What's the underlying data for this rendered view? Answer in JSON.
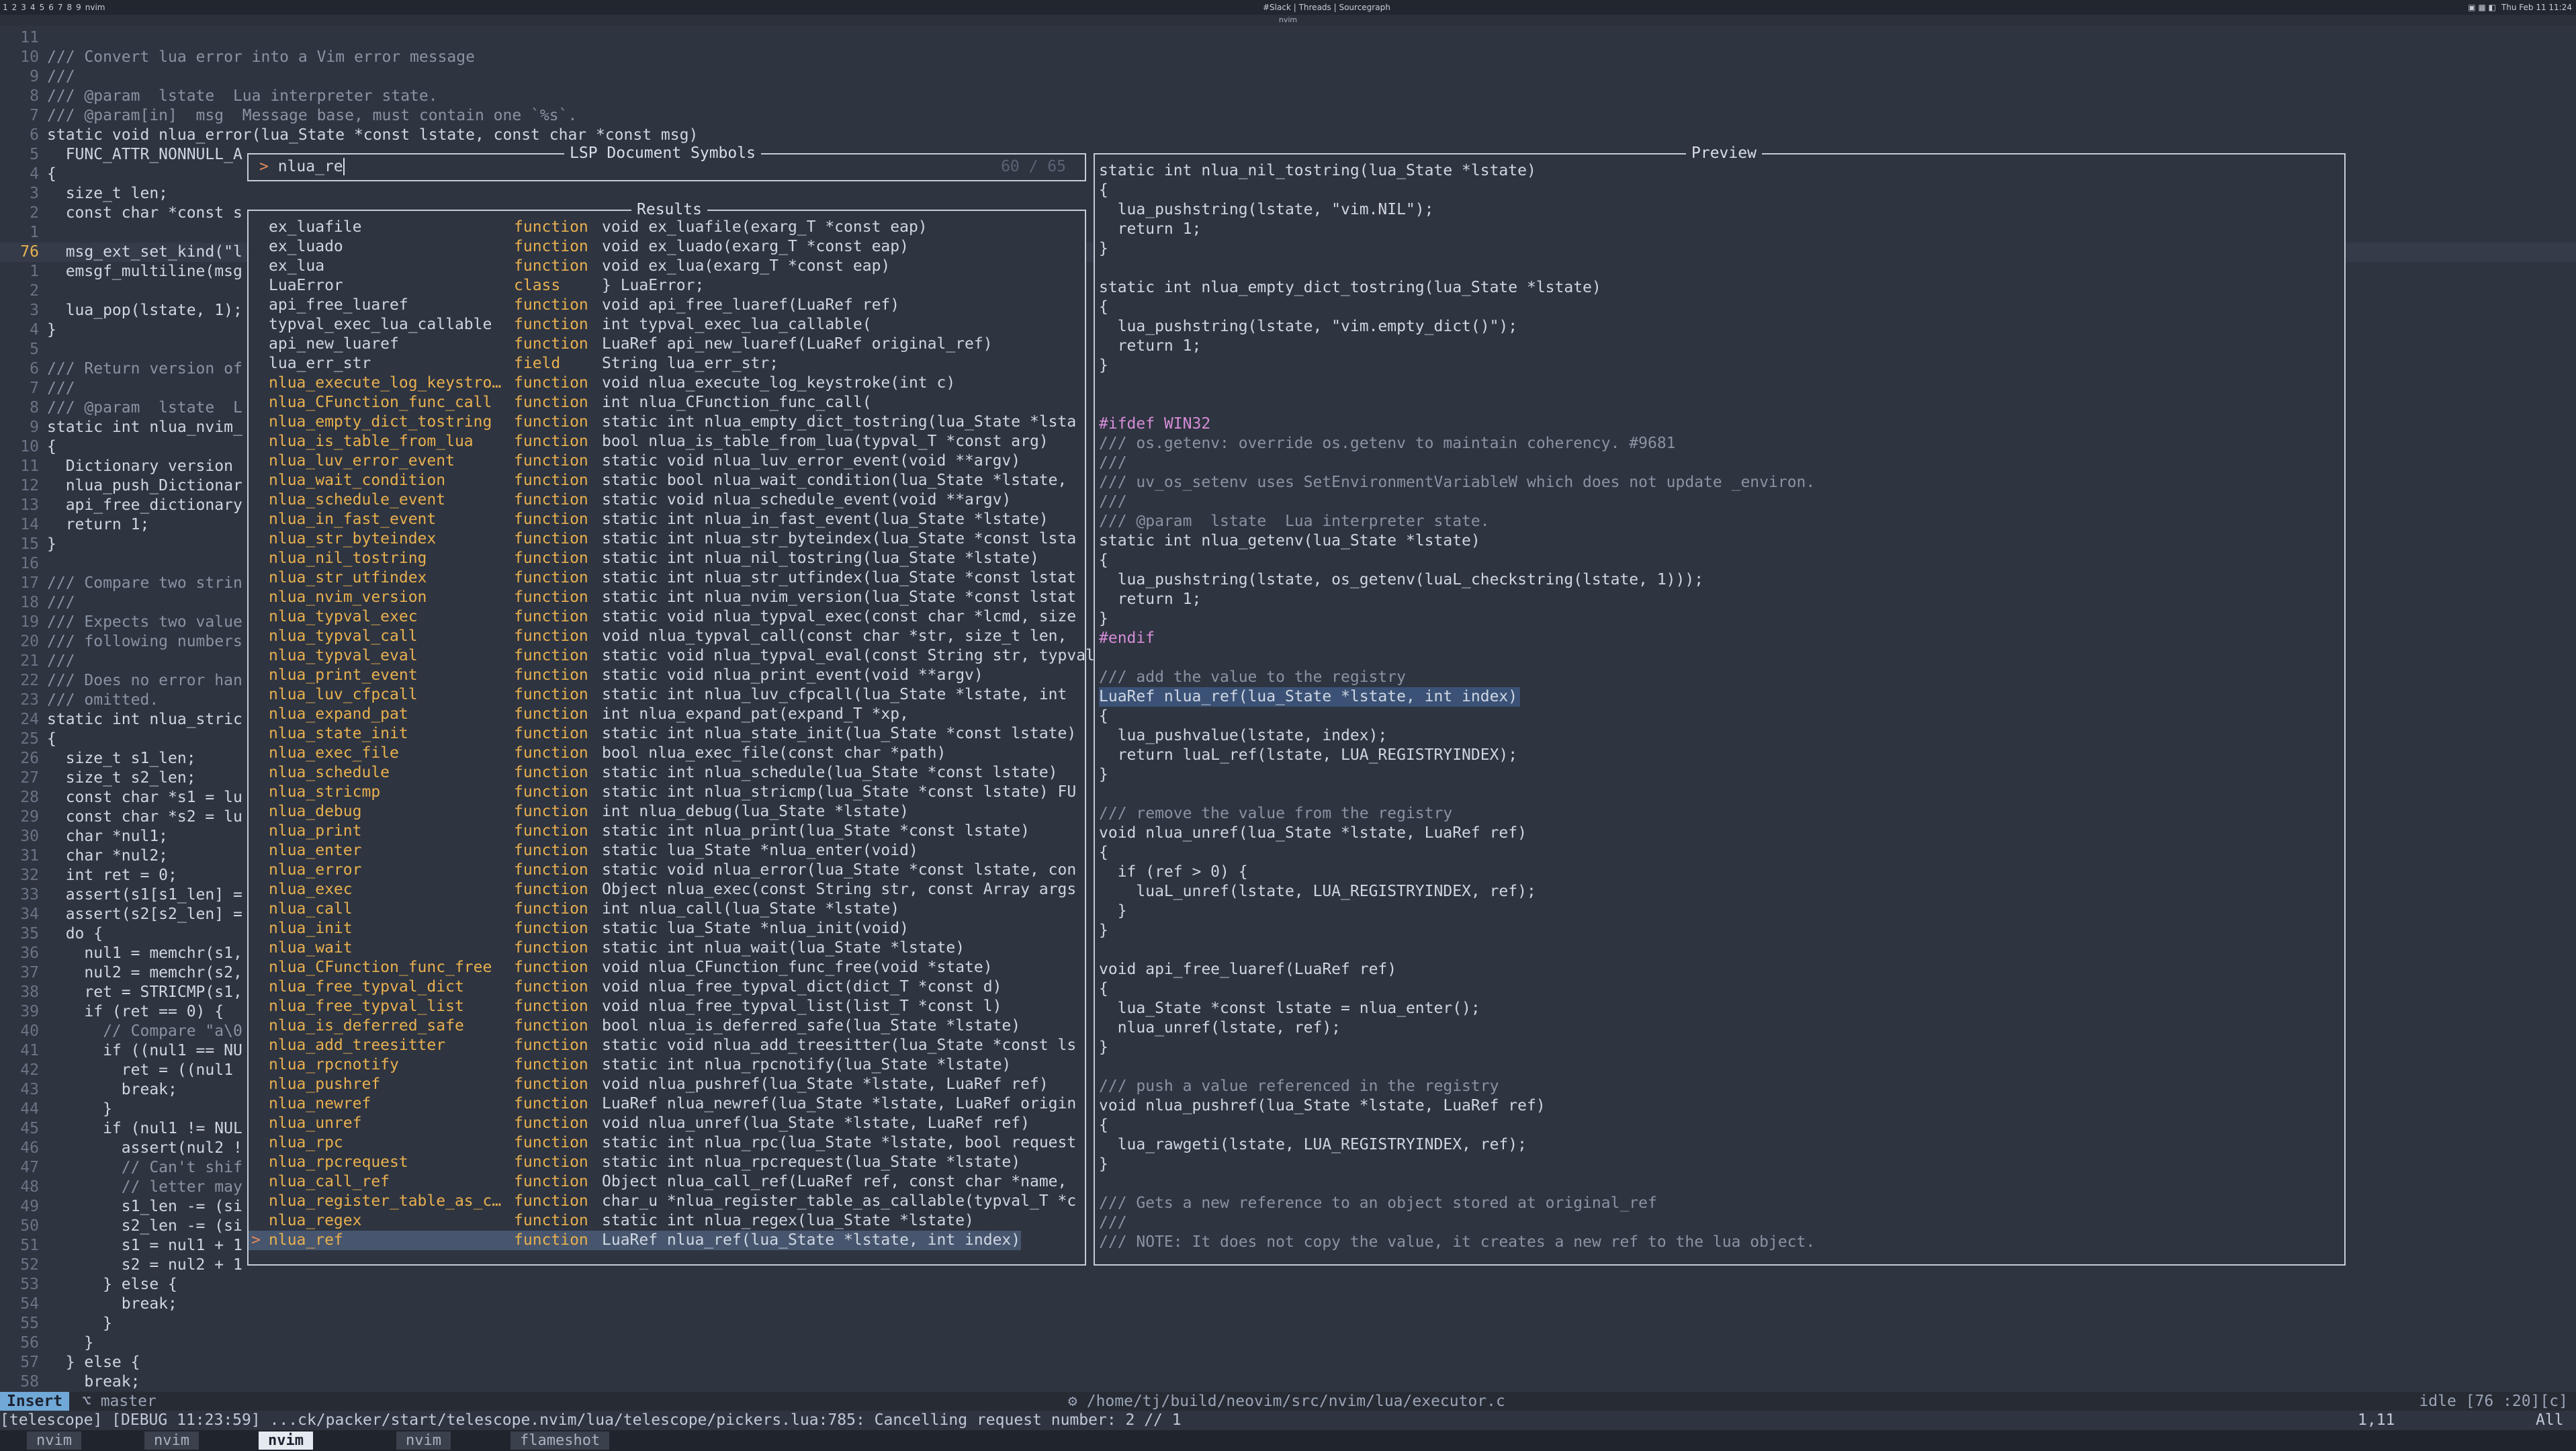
{
  "topbar": {
    "workspaces": [
      "1",
      "2",
      "3",
      "4",
      "5",
      "6",
      "7",
      "8",
      "9"
    ],
    "window_label": "nvim",
    "center": "#Slack | Threads | Sourcegraph",
    "right": "Thu Feb 11 11:24"
  },
  "window_title": "nvim",
  "editor": {
    "lines": [
      {
        "n": "11",
        "t": ""
      },
      {
        "n": "10",
        "t": "/// Convert lua error into a Vim error message"
      },
      {
        "n": "9",
        "t": "///"
      },
      {
        "n": "8",
        "t": "/// @param  lstate  Lua interpreter state."
      },
      {
        "n": "7",
        "t": "/// @param[in]  msg  Message base, must contain one `%s`."
      },
      {
        "n": "6",
        "t": "static void nlua_error(lua_State *const lstate, const char *const msg)"
      },
      {
        "n": "5",
        "t": "  FUNC_ATTR_NONNULL_A"
      },
      {
        "n": "4",
        "t": "{"
      },
      {
        "n": "3",
        "t": "  size_t len;"
      },
      {
        "n": "2",
        "t": "  const char *const s"
      },
      {
        "n": "1",
        "t": ""
      },
      {
        "n": "76",
        "t": "  msg_ext_set_kind(\"l"
      },
      {
        "n": "1",
        "t": "  emsgf_multiline(msg"
      },
      {
        "n": "2",
        "t": ""
      },
      {
        "n": "3",
        "t": "  lua_pop(lstate, 1);"
      },
      {
        "n": "4",
        "t": "}"
      },
      {
        "n": "5",
        "t": ""
      },
      {
        "n": "6",
        "t": "/// Return version of"
      },
      {
        "n": "7",
        "t": "///"
      },
      {
        "n": "8",
        "t": "/// @param  lstate  L"
      },
      {
        "n": "9",
        "t": "static int nlua_nvim_"
      },
      {
        "n": "10",
        "t": "{"
      },
      {
        "n": "11",
        "t": "  Dictionary version"
      },
      {
        "n": "12",
        "t": "  nlua_push_Dictionar"
      },
      {
        "n": "13",
        "t": "  api_free_dictionary"
      },
      {
        "n": "14",
        "t": "  return 1;"
      },
      {
        "n": "15",
        "t": "}"
      },
      {
        "n": "16",
        "t": ""
      },
      {
        "n": "17",
        "t": "/// Compare two strin"
      },
      {
        "n": "18",
        "t": "///"
      },
      {
        "n": "19",
        "t": "/// Expects two value"
      },
      {
        "n": "20",
        "t": "/// following numbers"
      },
      {
        "n": "21",
        "t": "///"
      },
      {
        "n": "22",
        "t": "/// Does no error han"
      },
      {
        "n": "23",
        "t": "/// omitted."
      },
      {
        "n": "24",
        "t": "static int nlua_stric"
      },
      {
        "n": "25",
        "t": "{"
      },
      {
        "n": "26",
        "t": "  size_t s1_len;"
      },
      {
        "n": "27",
        "t": "  size_t s2_len;"
      },
      {
        "n": "28",
        "t": "  const char *s1 = lu"
      },
      {
        "n": "29",
        "t": "  const char *s2 = lu"
      },
      {
        "n": "30",
        "t": "  char *nul1;"
      },
      {
        "n": "31",
        "t": "  char *nul2;"
      },
      {
        "n": "32",
        "t": "  int ret = 0;"
      },
      {
        "n": "33",
        "t": "  assert(s1[s1_len] ="
      },
      {
        "n": "34",
        "t": "  assert(s2[s2_len] ="
      },
      {
        "n": "35",
        "t": "  do {"
      },
      {
        "n": "36",
        "t": "    nul1 = memchr(s1,"
      },
      {
        "n": "37",
        "t": "    nul2 = memchr(s2,"
      },
      {
        "n": "38",
        "t": "    ret = STRICMP(s1,"
      },
      {
        "n": "39",
        "t": "    if (ret == 0) {"
      },
      {
        "n": "40",
        "t": "      // Compare \"a\\0"
      },
      {
        "n": "41",
        "t": "      if ((nul1 == NU"
      },
      {
        "n": "42",
        "t": "        ret = ((nul1"
      },
      {
        "n": "43",
        "t": "        break;"
      },
      {
        "n": "44",
        "t": "      }"
      },
      {
        "n": "45",
        "t": "      if (nul1 != NUL"
      },
      {
        "n": "46",
        "t": "        assert(nul2 !"
      },
      {
        "n": "47",
        "t": "        // Can't shif"
      },
      {
        "n": "48",
        "t": "        // letter may"
      },
      {
        "n": "49",
        "t": "        s1_len -= (si"
      },
      {
        "n": "50",
        "t": "        s2_len -= (si"
      },
      {
        "n": "51",
        "t": "        s1 = nul1 + 1"
      },
      {
        "n": "52",
        "t": "        s2 = nul2 + 1"
      },
      {
        "n": "53",
        "t": "      } else {"
      },
      {
        "n": "54",
        "t": "        break;"
      },
      {
        "n": "55",
        "t": "      }"
      },
      {
        "n": "56",
        "t": "    }"
      },
      {
        "n": "57",
        "t": "  } else {"
      },
      {
        "n": "58",
        "t": "    break;"
      }
    ]
  },
  "picker": {
    "title": "LSP Document Symbols",
    "prompt_symbol": ">",
    "query": "nlua_re",
    "count": "60 / 65",
    "results_title": "Results",
    "selection_caret": ">",
    "results": [
      {
        "name": "ex_luafile",
        "kind": "function",
        "sig": "void ex_luafile(exarg_T *const eap)"
      },
      {
        "name": "ex_luado",
        "kind": "function",
        "sig": "void ex_luado(exarg_T *const eap)"
      },
      {
        "name": "ex_lua",
        "kind": "function",
        "sig": "void ex_lua(exarg_T *const eap)"
      },
      {
        "name": "LuaError",
        "kind": "class",
        "sig": "} LuaError;"
      },
      {
        "name": "api_free_luaref",
        "kind": "function",
        "sig": "void api_free_luaref(LuaRef ref)"
      },
      {
        "name": "typval_exec_lua_callable",
        "kind": "function",
        "sig": "int typval_exec_lua_callable("
      },
      {
        "name": "api_new_luaref",
        "kind": "function",
        "sig": "LuaRef api_new_luaref(LuaRef original_ref)"
      },
      {
        "name": "lua_err_str",
        "kind": "field",
        "sig": "String lua_err_str;"
      },
      {
        "name": "nlua_execute_log_keystro…",
        "kind": "function",
        "sig": "void nlua_execute_log_keystroke(int c)"
      },
      {
        "name": "nlua_CFunction_func_call",
        "kind": "function",
        "sig": "int nlua_CFunction_func_call("
      },
      {
        "name": "nlua_empty_dict_tostring",
        "kind": "function",
        "sig": "static int nlua_empty_dict_tostring(lua_State *lsta"
      },
      {
        "name": "nlua_is_table_from_lua",
        "kind": "function",
        "sig": "bool nlua_is_table_from_lua(typval_T *const arg)"
      },
      {
        "name": "nlua_luv_error_event",
        "kind": "function",
        "sig": "static void nlua_luv_error_event(void **argv)"
      },
      {
        "name": "nlua_wait_condition",
        "kind": "function",
        "sig": "static bool nlua_wait_condition(lua_State *lstate,"
      },
      {
        "name": "nlua_schedule_event",
        "kind": "function",
        "sig": "static void nlua_schedule_event(void **argv)"
      },
      {
        "name": "nlua_in_fast_event",
        "kind": "function",
        "sig": "static int nlua_in_fast_event(lua_State *lstate)"
      },
      {
        "name": "nlua_str_byteindex",
        "kind": "function",
        "sig": "static int nlua_str_byteindex(lua_State *const lsta"
      },
      {
        "name": "nlua_nil_tostring",
        "kind": "function",
        "sig": "static int nlua_nil_tostring(lua_State *lstate)"
      },
      {
        "name": "nlua_str_utfindex",
        "kind": "function",
        "sig": "static int nlua_str_utfindex(lua_State *const lstat"
      },
      {
        "name": "nlua_nvim_version",
        "kind": "function",
        "sig": "static int nlua_nvim_version(lua_State *const lstat"
      },
      {
        "name": "nlua_typval_exec",
        "kind": "function",
        "sig": "static void nlua_typval_exec(const char *lcmd, size"
      },
      {
        "name": "nlua_typval_call",
        "kind": "function",
        "sig": "void nlua_typval_call(const char *str, size_t len,"
      },
      {
        "name": "nlua_typval_eval",
        "kind": "function",
        "sig": "static void nlua_typval_eval(const String str, typval_T *c"
      },
      {
        "name": "nlua_print_event",
        "kind": "function",
        "sig": "static void nlua_print_event(void **argv)"
      },
      {
        "name": "nlua_luv_cfpcall",
        "kind": "function",
        "sig": "static int nlua_luv_cfpcall(lua_State *lstate, int"
      },
      {
        "name": "nlua_expand_pat",
        "kind": "function",
        "sig": "int nlua_expand_pat(expand_T *xp,"
      },
      {
        "name": "nlua_state_init",
        "kind": "function",
        "sig": "static int nlua_state_init(lua_State *const lstate)"
      },
      {
        "name": "nlua_exec_file",
        "kind": "function",
        "sig": "bool nlua_exec_file(const char *path)"
      },
      {
        "name": "nlua_schedule",
        "kind": "function",
        "sig": "static int nlua_schedule(lua_State *const lstate)"
      },
      {
        "name": "nlua_stricmp",
        "kind": "function",
        "sig": "static int nlua_stricmp(lua_State *const lstate) FU"
      },
      {
        "name": "nlua_debug",
        "kind": "function",
        "sig": "int nlua_debug(lua_State *lstate)"
      },
      {
        "name": "nlua_print",
        "kind": "function",
        "sig": "static int nlua_print(lua_State *const lstate)"
      },
      {
        "name": "nlua_enter",
        "kind": "function",
        "sig": "static lua_State *nlua_enter(void)"
      },
      {
        "name": "nlua_error",
        "kind": "function",
        "sig": "static void nlua_error(lua_State *const lstate, con"
      },
      {
        "name": "nlua_exec",
        "kind": "function",
        "sig": "Object nlua_exec(const String str, const Array args"
      },
      {
        "name": "nlua_call",
        "kind": "function",
        "sig": "int nlua_call(lua_State *lstate)"
      },
      {
        "name": "nlua_init",
        "kind": "function",
        "sig": "static lua_State *nlua_init(void)"
      },
      {
        "name": "nlua_wait",
        "kind": "function",
        "sig": "static int nlua_wait(lua_State *lstate)"
      },
      {
        "name": "nlua_CFunction_func_free",
        "kind": "function",
        "sig": "void nlua_CFunction_func_free(void *state)"
      },
      {
        "name": "nlua_free_typval_dict",
        "kind": "function",
        "sig": "void nlua_free_typval_dict(dict_T *const d)"
      },
      {
        "name": "nlua_free_typval_list",
        "kind": "function",
        "sig": "void nlua_free_typval_list(list_T *const l)"
      },
      {
        "name": "nlua_is_deferred_safe",
        "kind": "function",
        "sig": "bool nlua_is_deferred_safe(lua_State *lstate)"
      },
      {
        "name": "nlua_add_treesitter",
        "kind": "function",
        "sig": "static void nlua_add_treesitter(lua_State *const ls"
      },
      {
        "name": "nlua_rpcnotify",
        "kind": "function",
        "sig": "static int nlua_rpcnotify(lua_State *lstate)"
      },
      {
        "name": "nlua_pushref",
        "kind": "function",
        "sig": "void nlua_pushref(lua_State *lstate, LuaRef ref)"
      },
      {
        "name": "nlua_newref",
        "kind": "function",
        "sig": "LuaRef nlua_newref(lua_State *lstate, LuaRef origin"
      },
      {
        "name": "nlua_unref",
        "kind": "function",
        "sig": "void nlua_unref(lua_State *lstate, LuaRef ref)"
      },
      {
        "name": "nlua_rpc",
        "kind": "function",
        "sig": "static int nlua_rpc(lua_State *lstate, bool request"
      },
      {
        "name": "nlua_rpcrequest",
        "kind": "function",
        "sig": "static int nlua_rpcrequest(lua_State *lstate)"
      },
      {
        "name": "nlua_call_ref",
        "kind": "function",
        "sig": "Object nlua_call_ref(LuaRef ref, const char *name,"
      },
      {
        "name": "nlua_register_table_as_c…",
        "kind": "function",
        "sig": "char_u *nlua_register_table_as_callable(typval_T *c"
      },
      {
        "name": "nlua_regex",
        "kind": "function",
        "sig": "static int nlua_regex(lua_State *lstate)"
      },
      {
        "name": "nlua_ref",
        "kind": "function",
        "sig": "LuaRef nlua_ref(lua_State *lstate, int index)"
      }
    ]
  },
  "preview": {
    "title": "Preview",
    "lines": [
      "static int nlua_nil_tostring(lua_State *lstate)",
      "{",
      "  lua_pushstring(lstate, \"vim.NIL\");",
      "  return 1;",
      "}",
      "",
      "static int nlua_empty_dict_tostring(lua_State *lstate)",
      "{",
      "  lua_pushstring(lstate, \"vim.empty_dict()\");",
      "  return 1;",
      "}",
      "",
      "",
      "#ifdef WIN32",
      "/// os.getenv: override os.getenv to maintain coherency. #9681",
      "///",
      "/// uv_os_setenv uses SetEnvironmentVariableW which does not update _environ.",
      "///",
      "/// @param  lstate  Lua interpreter state.",
      "static int nlua_getenv(lua_State *lstate)",
      "{",
      "  lua_pushstring(lstate, os_getenv(luaL_checkstring(lstate, 1)));",
      "  return 1;",
      "}",
      "#endif",
      "",
      "/// add the value to the registry",
      "LuaRef nlua_ref(lua_State *lstate, int index)",
      "{",
      "  lua_pushvalue(lstate, index);",
      "  return luaL_ref(lstate, LUA_REGISTRYINDEX);",
      "}",
      "",
      "/// remove the value from the registry",
      "void nlua_unref(lua_State *lstate, LuaRef ref)",
      "{",
      "  if (ref > 0) {",
      "    luaL_unref(lstate, LUA_REGISTRYINDEX, ref);",
      "  }",
      "}",
      "",
      "void api_free_luaref(LuaRef ref)",
      "{",
      "  lua_State *const lstate = nlua_enter();",
      "  nlua_unref(lstate, ref);",
      "}",
      "",
      "/// push a value referenced in the registry",
      "void nlua_pushref(lua_State *lstate, LuaRef ref)",
      "{",
      "  lua_rawgeti(lstate, LUA_REGISTRYINDEX, ref);",
      "}",
      "",
      "/// Gets a new reference to an object stored at original_ref",
      "///",
      "/// NOTE: It does not copy the value, it creates a new ref to the lua object."
    ]
  },
  "statusline": {
    "mode": "Insert",
    "branch": "master",
    "file_icon": "⚙",
    "file": "/home/tj/build/neovim/src/nvim/lua/executor.c",
    "right": "idle [76 :20][c]"
  },
  "messages": {
    "text": "[telescope] [DEBUG 11:23:59] ...ck/packer/start/telescope.nvim/lua/telescope/pickers.lua:785: Cancelling request number: 2  //  1",
    "position": "1,11",
    "scroll": "All"
  },
  "tmux": {
    "tabs": [
      "nvim",
      "nvim",
      "nvim",
      "nvim",
      "flameshot"
    ],
    "active": 2
  }
}
